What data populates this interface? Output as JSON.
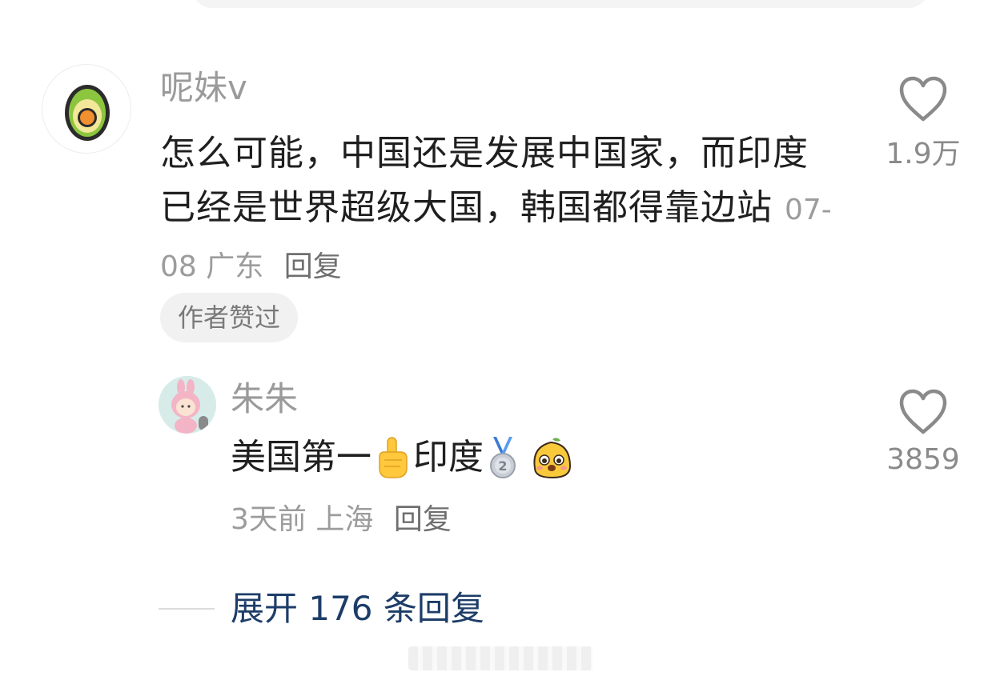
{
  "main_comment": {
    "username": "呢妹v",
    "text": "怎么可能，中国还是发展中国家，而印度已经是世界超级大国，韩国都得靠边站",
    "date": "07-08",
    "location": "广东",
    "reply_label": "回复",
    "badge": "作者赞过",
    "like_count": "1.9万",
    "avatar_icon": "avocado-icon"
  },
  "reply_comment": {
    "username": "朱朱",
    "text_part1": "美国第一",
    "text_part2": "印度",
    "emoji": [
      "pointing-up-icon",
      "silver-medal-icon",
      "cartoon-face-icon"
    ],
    "time": "3天前",
    "location": "上海",
    "reply_label": "回复",
    "like_count": "3859",
    "avatar_icon": "bunny-hood-avatar-icon"
  },
  "expand_replies": {
    "label": "展开 176 条回复"
  },
  "colors": {
    "username": "#9a9a9a",
    "text": "#1f1f1f",
    "meta": "#9c9c9c",
    "link": "#1d3d68",
    "badge_bg": "#f1f1f1"
  }
}
